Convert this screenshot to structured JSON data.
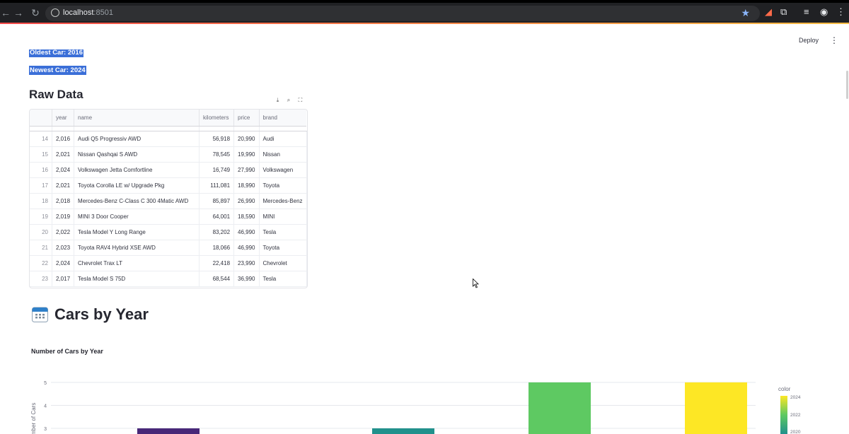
{
  "browser": {
    "url_host": "localhost",
    "url_port": ":8501"
  },
  "app": {
    "deploy_label": "Deploy",
    "menu_icon": "vertical-dots-icon",
    "oldest_car": "Oldest Car: 2016",
    "newest_car": "Newest Car: 2024",
    "raw_data_title": "Raw Data",
    "cars_by_year_title": "Cars by Year",
    "cars_by_year_icon": "calendar-icon"
  },
  "table": {
    "columns": [
      "",
      "year",
      "name",
      "kilometers",
      "price",
      "brand"
    ],
    "rows": [
      [
        "14",
        "2,016",
        "Audi Q5 Progressiv AWD",
        "56,918",
        "20,990",
        "Audi"
      ],
      [
        "15",
        "2,021",
        "Nissan Qashqai S AWD",
        "78,545",
        "19,990",
        "Nissan"
      ],
      [
        "16",
        "2,024",
        "Volkswagen Jetta Comfortline",
        "16,749",
        "27,990",
        "Volkswagen"
      ],
      [
        "17",
        "2,021",
        "Toyota Corolla LE w/ Upgrade Pkg",
        "111,081",
        "18,990",
        "Toyota"
      ],
      [
        "18",
        "2,018",
        "Mercedes-Benz C-Class C 300 4Matic AWD",
        "85,897",
        "26,990",
        "Mercedes-Benz"
      ],
      [
        "19",
        "2,019",
        "MINI 3 Door Cooper",
        "64,001",
        "18,590",
        "MINI"
      ],
      [
        "20",
        "2,022",
        "Tesla Model Y Long Range",
        "83,202",
        "46,990",
        "Tesla"
      ],
      [
        "21",
        "2,023",
        "Toyota RAV4 Hybrid XSE AWD",
        "18,066",
        "46,990",
        "Toyota"
      ],
      [
        "22",
        "2,024",
        "Chevrolet Trax LT",
        "22,418",
        "23,990",
        "Chevrolet"
      ],
      [
        "23",
        "2,017",
        "Tesla Model S 75D",
        "68,544",
        "36,990",
        "Tesla"
      ]
    ]
  },
  "chart_data": {
    "type": "bar",
    "title": "Number of Cars by Year",
    "ylabel": "Number of Cars",
    "y_ticks": [
      3,
      4,
      5
    ],
    "bars": [
      {
        "value": 3,
        "color": "#482878"
      },
      {
        "value": 3,
        "color": "#21918c"
      },
      {
        "value": 5,
        "color": "#5ec962"
      },
      {
        "value": 5,
        "color": "#fde725"
      }
    ],
    "legend": {
      "title": "color",
      "ticks": [
        "2024",
        "2022",
        "2020"
      ]
    }
  }
}
